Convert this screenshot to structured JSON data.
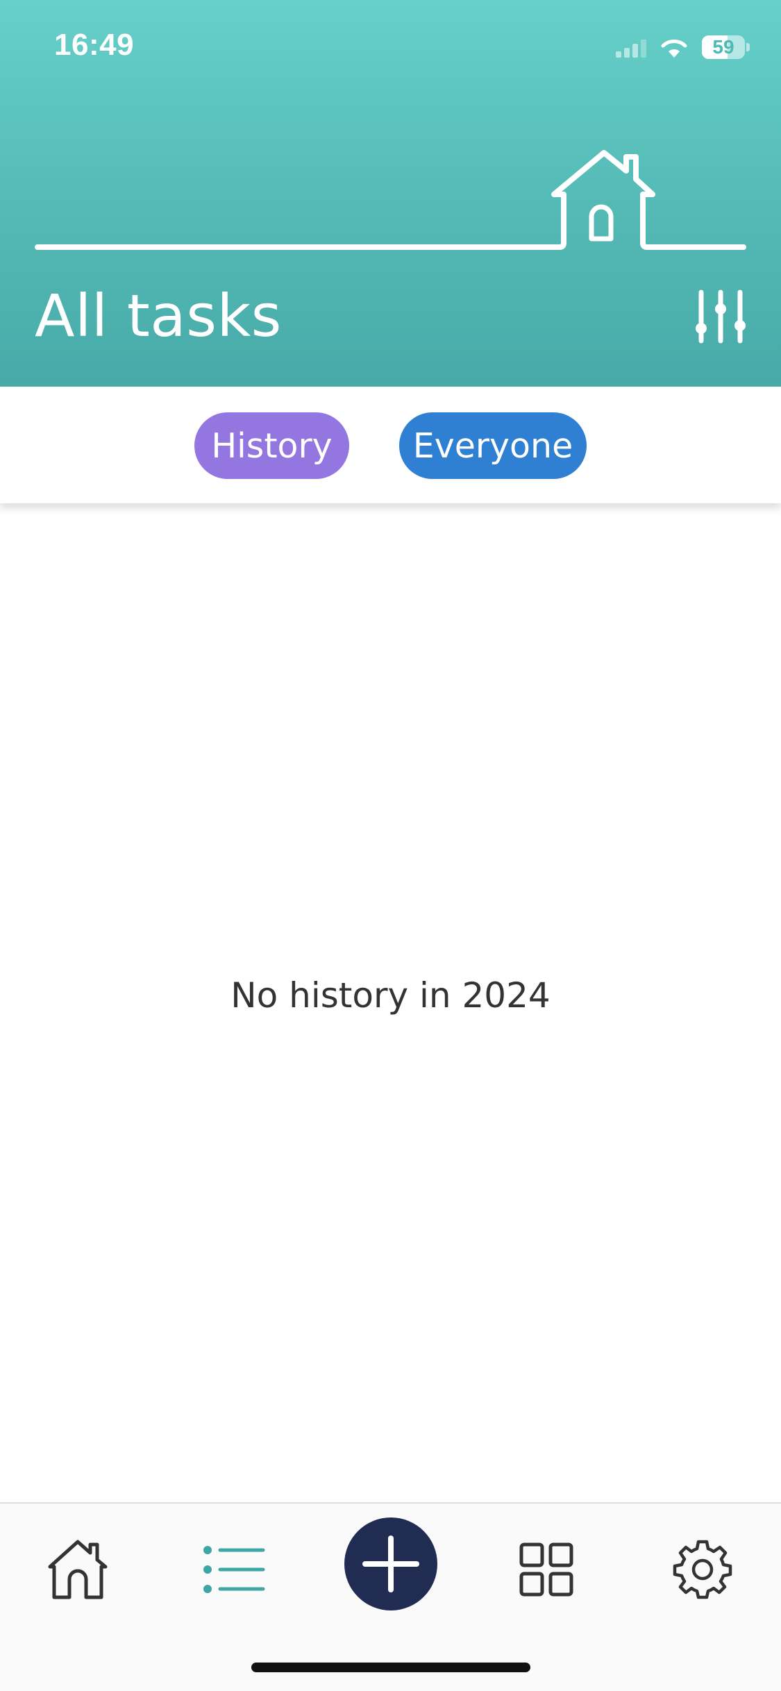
{
  "status_bar": {
    "time": "16:49",
    "battery": "59",
    "battery_level": 0.59
  },
  "header": {
    "title": "All tasks",
    "filter_icon": "sliders-icon",
    "illustration": "house-outline-icon"
  },
  "filters": {
    "history_label": "History",
    "everyone_label": "Everyone",
    "history_color": "#9376e0",
    "everyone_color": "#2f80d3"
  },
  "content": {
    "empty_message": "No history in 2024"
  },
  "tab_bar": {
    "items": [
      {
        "icon": "home-icon",
        "active": false
      },
      {
        "icon": "list-icon",
        "active": true
      },
      {
        "icon": "plus-icon",
        "active": false
      },
      {
        "icon": "grid-icon",
        "active": false
      },
      {
        "icon": "gear-icon",
        "active": false
      }
    ]
  },
  "colors": {
    "header_gradient_top": "#66d0c9",
    "header_gradient_bottom": "#47aaa8",
    "add_button": "#212c52",
    "active_tab": "#3fa6a6"
  }
}
